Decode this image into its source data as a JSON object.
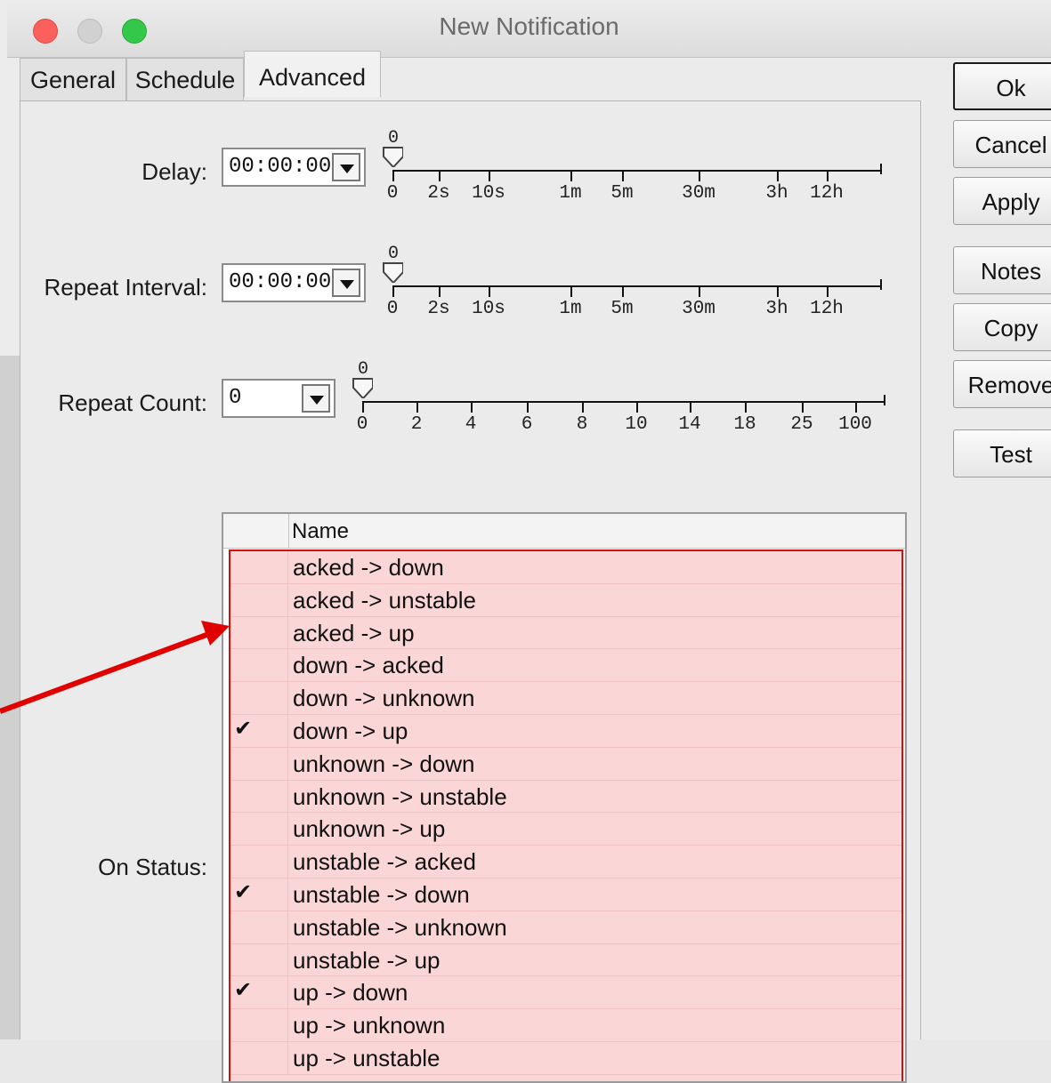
{
  "window": {
    "title": "New Notification"
  },
  "tabs": [
    {
      "label": "General"
    },
    {
      "label": "Schedule"
    },
    {
      "label": "Advanced"
    }
  ],
  "delay": {
    "label": "Delay:",
    "value": "00:00:00",
    "slider_value": "0",
    "ticks": [
      "0",
      "2s",
      "10s",
      "1m",
      "5m",
      "30m",
      "3h",
      "12h"
    ]
  },
  "repeat_interval": {
    "label": "Repeat Interval:",
    "value": "00:00:00",
    "slider_value": "0",
    "ticks": [
      "0",
      "2s",
      "10s",
      "1m",
      "5m",
      "30m",
      "3h",
      "12h"
    ]
  },
  "repeat_count": {
    "label": "Repeat Count:",
    "value": "0",
    "slider_value": "0",
    "ticks": [
      "0",
      "2",
      "4",
      "6",
      "8",
      "10",
      "14",
      "18",
      "25",
      "100"
    ]
  },
  "on_status": {
    "label": "On Status:",
    "column_header": "Name",
    "rows": [
      {
        "checked": false,
        "name": "acked -> down"
      },
      {
        "checked": false,
        "name": "acked -> unstable"
      },
      {
        "checked": false,
        "name": "acked -> up"
      },
      {
        "checked": false,
        "name": "down -> acked"
      },
      {
        "checked": false,
        "name": "down -> unknown"
      },
      {
        "checked": true,
        "name": "down -> up"
      },
      {
        "checked": false,
        "name": "unknown -> down"
      },
      {
        "checked": false,
        "name": "unknown -> unstable"
      },
      {
        "checked": false,
        "name": "unknown -> up"
      },
      {
        "checked": false,
        "name": "unstable -> acked"
      },
      {
        "checked": true,
        "name": "unstable -> down"
      },
      {
        "checked": false,
        "name": "unstable -> unknown"
      },
      {
        "checked": false,
        "name": "unstable -> up"
      },
      {
        "checked": true,
        "name": "up -> down"
      },
      {
        "checked": false,
        "name": "up -> unknown"
      },
      {
        "checked": false,
        "name": "up -> unstable"
      }
    ],
    "check_glyph": "✔"
  },
  "buttons": {
    "ok": "Ok",
    "cancel": "Cancel",
    "apply": "Apply",
    "notes": "Notes",
    "copy": "Copy",
    "remove": "Remove",
    "test": "Test"
  },
  "colors": {
    "highlight_fill": "#fbd6d6",
    "highlight_border": "#d80e0e",
    "annotation_arrow": "#e00000"
  }
}
